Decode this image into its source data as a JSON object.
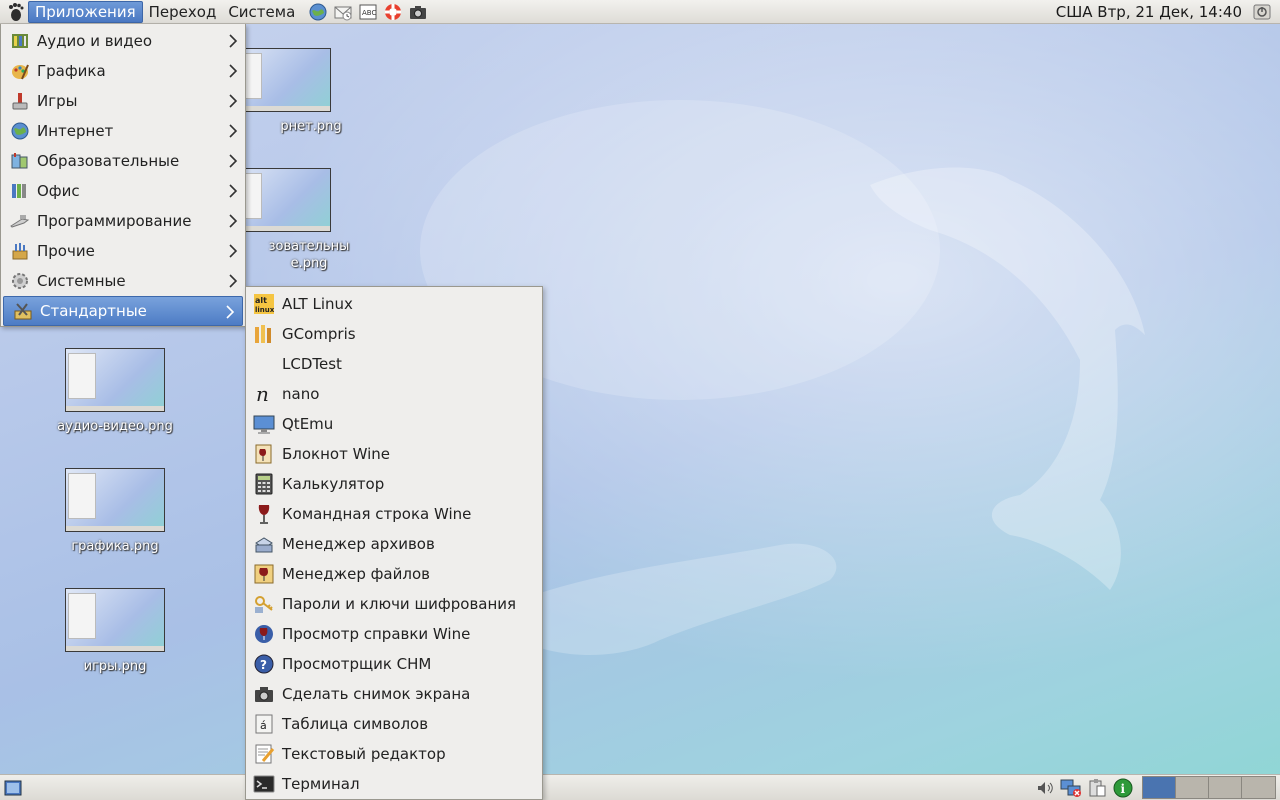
{
  "top_panel": {
    "menus": [
      "Приложения",
      "Переход",
      "Система"
    ],
    "launchers": [
      "browser-icon",
      "mail-icon",
      "office-icon",
      "help-icon",
      "screenshot-icon"
    ],
    "clock": "США Втр, 21 Дек, 14:40"
  },
  "apps_menu": {
    "items": [
      {
        "label": "Аудио и видео",
        "icon": "multimedia-icon"
      },
      {
        "label": "Графика",
        "icon": "graphics-icon"
      },
      {
        "label": "Игры",
        "icon": "games-icon"
      },
      {
        "label": "Интернет",
        "icon": "globe-icon"
      },
      {
        "label": "Образовательные",
        "icon": "education-icon"
      },
      {
        "label": "Офис",
        "icon": "office-icon"
      },
      {
        "label": "Программирование",
        "icon": "programming-icon"
      },
      {
        "label": "Прочие",
        "icon": "other-icon"
      },
      {
        "label": "Системные",
        "icon": "system-gear-icon"
      },
      {
        "label": "Стандартные",
        "icon": "accessories-icon"
      }
    ],
    "selected": "Стандартные"
  },
  "accessories_menu": {
    "items": [
      {
        "label": "ALT Linux",
        "icon": "altlinux-icon"
      },
      {
        "label": "GCompris",
        "icon": "gcompris-icon"
      },
      {
        "label": "LCDTest",
        "icon": "blank-icon"
      },
      {
        "label": "nano",
        "icon": "nano-icon"
      },
      {
        "label": "QtEmu",
        "icon": "qtemu-icon"
      },
      {
        "label": "Блокнот Wine",
        "icon": "wine-notepad-icon"
      },
      {
        "label": "Калькулятор",
        "icon": "calculator-icon"
      },
      {
        "label": "Командная строка Wine",
        "icon": "wine-icon"
      },
      {
        "label": "Менеджер архивов",
        "icon": "archive-manager-icon"
      },
      {
        "label": "Менеджер файлов",
        "icon": "wine-file-manager-icon"
      },
      {
        "label": "Пароли и ключи шифрования",
        "icon": "keys-icon"
      },
      {
        "label": "Просмотр справки Wine",
        "icon": "wine-help-icon"
      },
      {
        "label": "Просмотрщик CHM",
        "icon": "chm-viewer-icon"
      },
      {
        "label": "Сделать снимок экрана",
        "icon": "camera-icon"
      },
      {
        "label": "Таблица символов",
        "icon": "charmap-icon"
      },
      {
        "label": "Текстовый редактор",
        "icon": "text-editor-icon"
      },
      {
        "label": "Терминал",
        "icon": "terminal-icon"
      }
    ]
  },
  "desktop_icons": [
    {
      "label": "рнет.png"
    },
    {
      "label": "зовательны\nе.png"
    },
    {
      "label": "аудио-видео.png"
    },
    {
      "label": "графика.png"
    },
    {
      "label": "игры.png"
    }
  ],
  "bottom_panel": {
    "tray": [
      "volume-icon",
      "network-icon",
      "clipboard-icon",
      "info-icon"
    ],
    "workspaces": 4,
    "active_workspace": 1
  },
  "colors": {
    "selection": "#4d7cc5",
    "menu_bg": "#efeeec",
    "panel_bg": "#dedcd7",
    "active_workspace": "#4a74b0"
  }
}
